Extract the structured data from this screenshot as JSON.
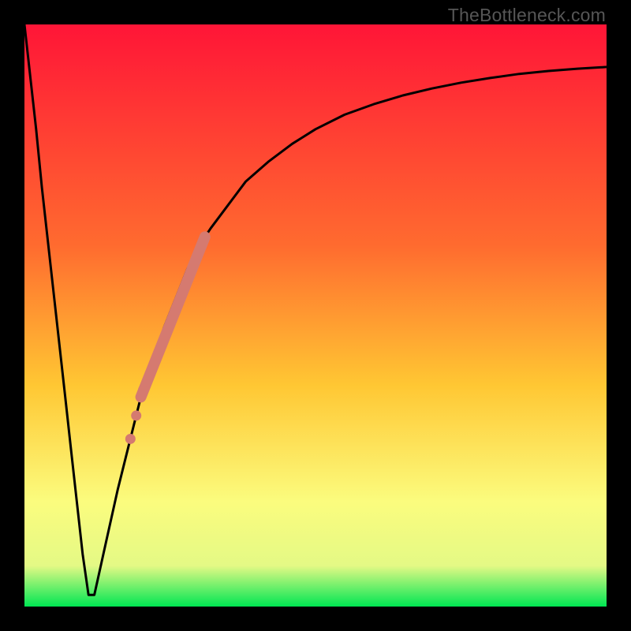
{
  "watermark": "TheBottleneck.com",
  "colors": {
    "frame": "#000000",
    "curve": "#000000",
    "marker": "#D57A70",
    "band": "#D57A70",
    "grad_top": "#FF1537",
    "grad_mid1": "#FF6B2F",
    "grad_mid2": "#FFC733",
    "grad_mid3": "#FBFC7E",
    "grad_mid4": "#E4F985",
    "grad_bot": "#00E653"
  },
  "chart_data": {
    "type": "line",
    "title": "",
    "xlabel": "",
    "ylabel": "",
    "xlim": [
      0,
      100
    ],
    "ylim": [
      0,
      100
    ],
    "x": [
      0,
      1,
      2,
      3,
      4,
      5,
      6,
      7,
      8,
      9,
      10,
      11,
      12,
      14,
      16,
      18,
      20,
      22,
      24,
      26,
      28,
      30,
      32,
      35,
      38,
      42,
      46,
      50,
      55,
      60,
      65,
      70,
      75,
      80,
      85,
      90,
      95,
      100
    ],
    "values": [
      100,
      91,
      82,
      72,
      63,
      54,
      45,
      36,
      27,
      18,
      9,
      2,
      2,
      11,
      20,
      28,
      36,
      42,
      48,
      53,
      58,
      62,
      65,
      69,
      73,
      76.5,
      79.5,
      82,
      84.5,
      86.3,
      87.8,
      89,
      90,
      90.8,
      91.5,
      92,
      92.4,
      92.7
    ],
    "highlight_band": {
      "x_start": 20,
      "x_end": 31
    },
    "markers_x": [
      18.2,
      19.2,
      20.4
    ]
  }
}
